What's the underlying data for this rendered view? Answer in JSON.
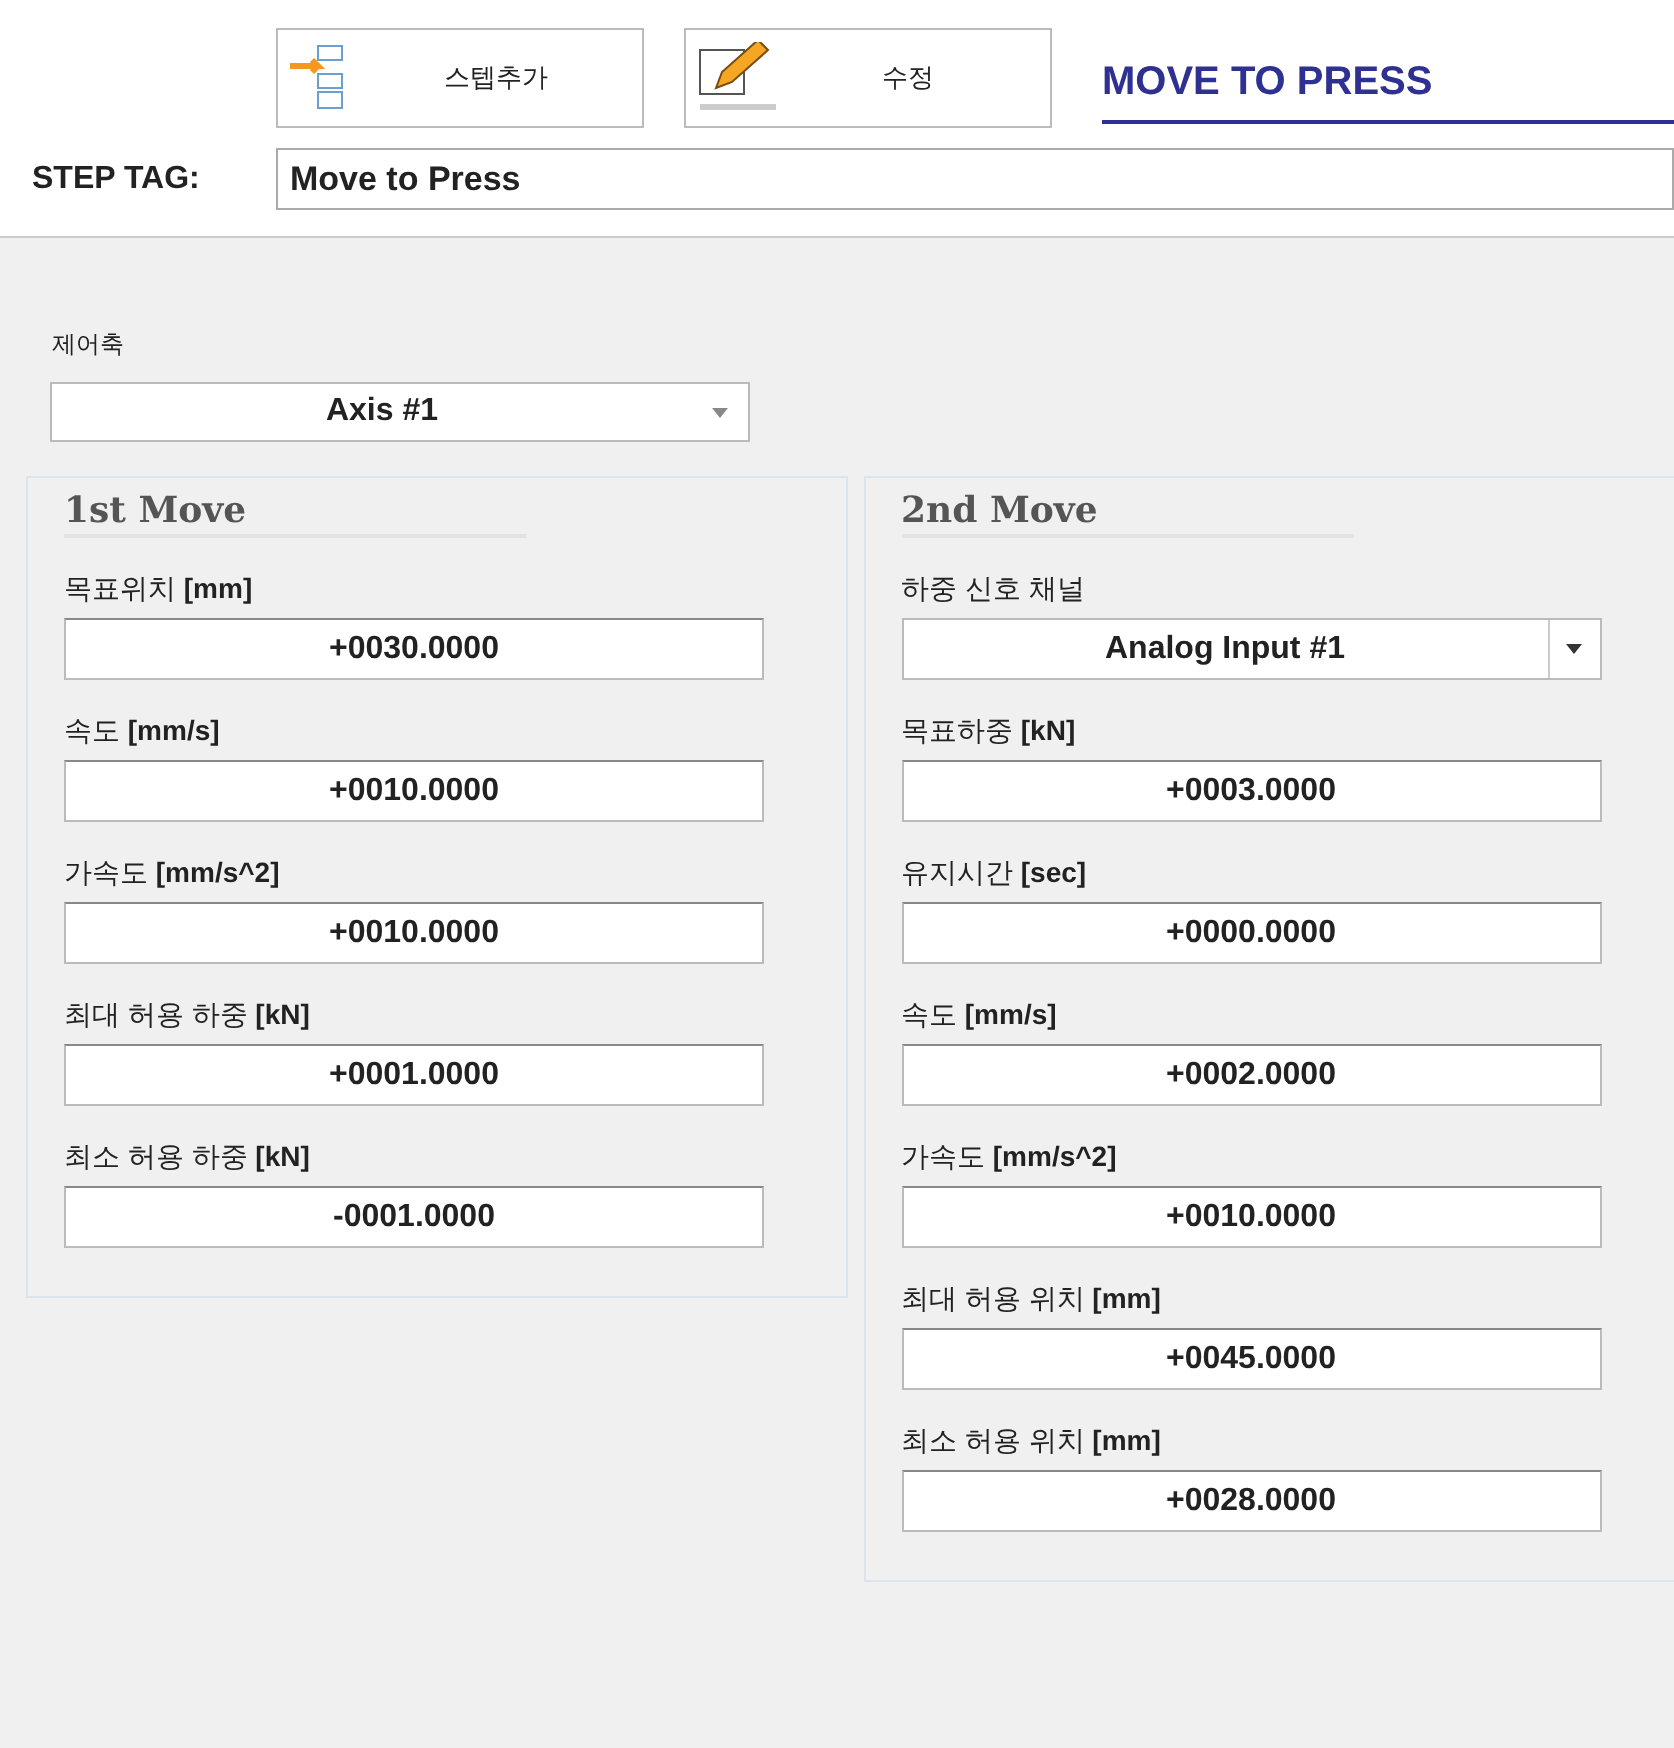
{
  "toolbar": {
    "buttons": [
      {
        "kind": "add-step",
        "label": "스텝추가"
      },
      {
        "kind": "edit",
        "label": "수정"
      }
    ],
    "title": "MOVE TO PRESS"
  },
  "step_tag": {
    "label": "STEP TAG:",
    "value": "Move to Press"
  },
  "axis": {
    "label": "제어축",
    "value": "Axis #1"
  },
  "panels": [
    {
      "title": "1st Move",
      "fields": [
        {
          "kind": "text",
          "label": "목표위치 **[mm]**",
          "value": "+0030.0000"
        },
        {
          "kind": "text",
          "label": "속도 **[mm/s]**",
          "value": "+0010.0000"
        },
        {
          "kind": "text",
          "label": "가속도 **[mm/s^2]**",
          "value": "+0010.0000"
        },
        {
          "kind": "text",
          "label": "최대 허용 하중 **[kN]**",
          "value": "+0001.0000"
        },
        {
          "kind": "text",
          "label": "최소 허용 하중 **[kN]**",
          "value": "-0001.0000"
        }
      ]
    },
    {
      "title": "2nd Move",
      "fields": [
        {
          "kind": "dropdown",
          "label": "하중 신호 채널",
          "value": "Analog Input #1"
        },
        {
          "kind": "text",
          "label": "목표하중 **[kN]**",
          "value": "+0003.0000"
        },
        {
          "kind": "text",
          "label": "유지시간 **[sec]**",
          "value": "+0000.0000"
        },
        {
          "kind": "text",
          "label": "속도 **[mm/s]**",
          "value": "+0002.0000"
        },
        {
          "kind": "text",
          "label": "가속도 **[mm/s^2]**",
          "value": "+0010.0000"
        },
        {
          "kind": "text",
          "label": "최대 허용 위치 **[mm]**",
          "value": "+0045.0000"
        },
        {
          "kind": "text",
          "label": "최소 허용 위치 **[mm]**",
          "value": "+0028.0000"
        }
      ]
    }
  ]
}
